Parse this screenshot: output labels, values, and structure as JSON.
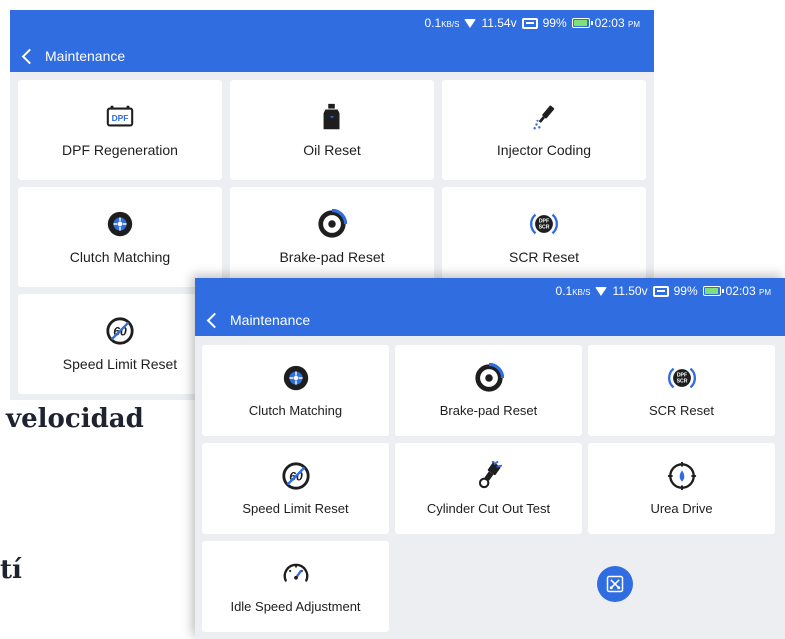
{
  "background_text": {
    "line1": "velocidad",
    "line2": "tí"
  },
  "screens": {
    "back": {
      "status": {
        "speed": "0.1",
        "speed_unit": "KB/S",
        "voltage": "11.54v",
        "battery": "99%",
        "time": "02:03",
        "ampm": "PM"
      },
      "title": "Maintenance",
      "tiles": [
        {
          "label": "DPF Regeneration",
          "icon": "dpf-icon"
        },
        {
          "label": "Oil Reset",
          "icon": "oil-bottle-icon"
        },
        {
          "label": "Injector Coding",
          "icon": "injector-icon"
        },
        {
          "label": "Clutch Matching",
          "icon": "clutch-icon"
        },
        {
          "label": "Brake-pad Reset",
          "icon": "brake-pad-icon"
        },
        {
          "label": "SCR Reset",
          "icon": "scr-icon"
        },
        {
          "label": "Speed Limit Reset",
          "icon": "speed-limit-icon"
        }
      ]
    },
    "front": {
      "status": {
        "speed": "0.1",
        "speed_unit": "KB/S",
        "voltage": "11.50v",
        "battery": "99%",
        "time": "02:03",
        "ampm": "PM"
      },
      "title": "Maintenance",
      "tiles": [
        {
          "label": "Clutch Matching",
          "icon": "clutch-icon"
        },
        {
          "label": "Brake-pad Reset",
          "icon": "brake-pad-icon"
        },
        {
          "label": "SCR Reset",
          "icon": "scr-icon"
        },
        {
          "label": "Speed Limit Reset",
          "icon": "speed-limit-icon"
        },
        {
          "label": "Cylinder Cut Out Test",
          "icon": "cylinder-icon"
        },
        {
          "label": "Urea Drive",
          "icon": "urea-icon"
        },
        {
          "label": "Idle Speed Adjustment",
          "icon": "gauge-icon"
        }
      ],
      "fab_icon": "tools-icon"
    }
  },
  "colors": {
    "accent": "#2f6de0",
    "background": "#edeef2",
    "tile": "#ffffff",
    "text": "#1e1e1e"
  }
}
